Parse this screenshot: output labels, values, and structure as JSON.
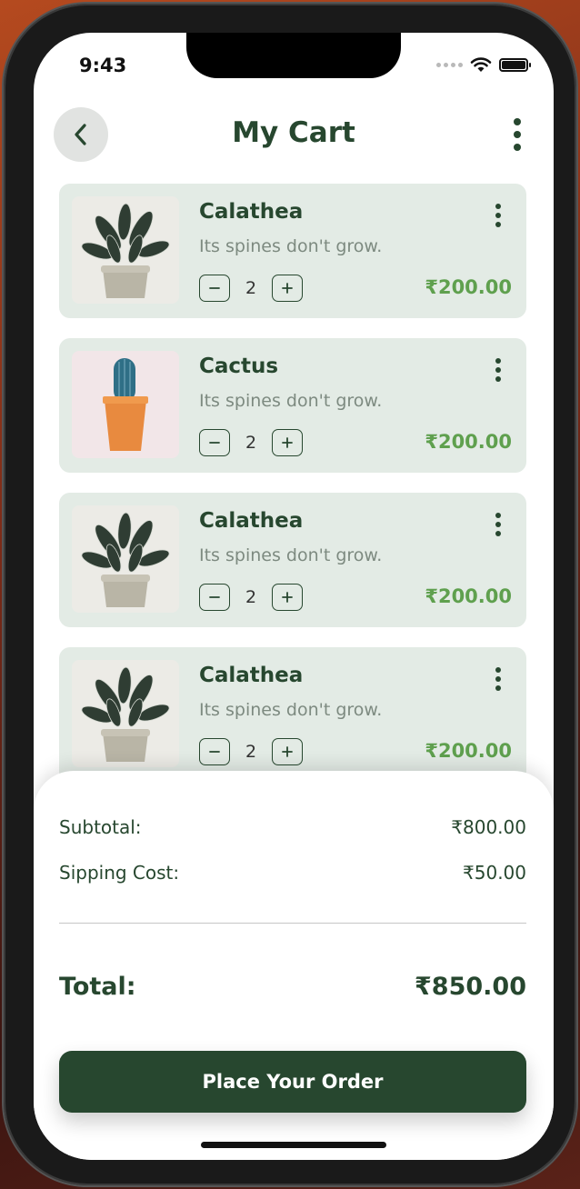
{
  "status_bar": {
    "time": "9:43"
  },
  "header": {
    "title": "My Cart"
  },
  "currency_symbol": "₹",
  "cart": {
    "items": [
      {
        "name": "Calathea",
        "description": "Its spines don't grow.",
        "quantity": "2",
        "price": "₹200.00",
        "image": "calathea"
      },
      {
        "name": "Cactus",
        "description": "Its spines don't grow.",
        "quantity": "2",
        "price": "₹200.00",
        "image": "cactus"
      },
      {
        "name": "Calathea",
        "description": "Its spines don't grow.",
        "quantity": "2",
        "price": "₹200.00",
        "image": "calathea"
      },
      {
        "name": "Calathea",
        "description": "Its spines don't grow.",
        "quantity": "2",
        "price": "₹200.00",
        "image": "calathea"
      }
    ]
  },
  "summary": {
    "subtotal_label": "Subtotal:",
    "subtotal_value": "₹800.00",
    "shipping_label": "Sipping Cost:",
    "shipping_value": "₹50.00",
    "total_label": "Total:",
    "total_value": "₹850.00",
    "order_button": "Place Your Order"
  },
  "colors": {
    "primary": "#27472f",
    "price": "#5fa04e",
    "card_bg": "#e3ebe5"
  }
}
